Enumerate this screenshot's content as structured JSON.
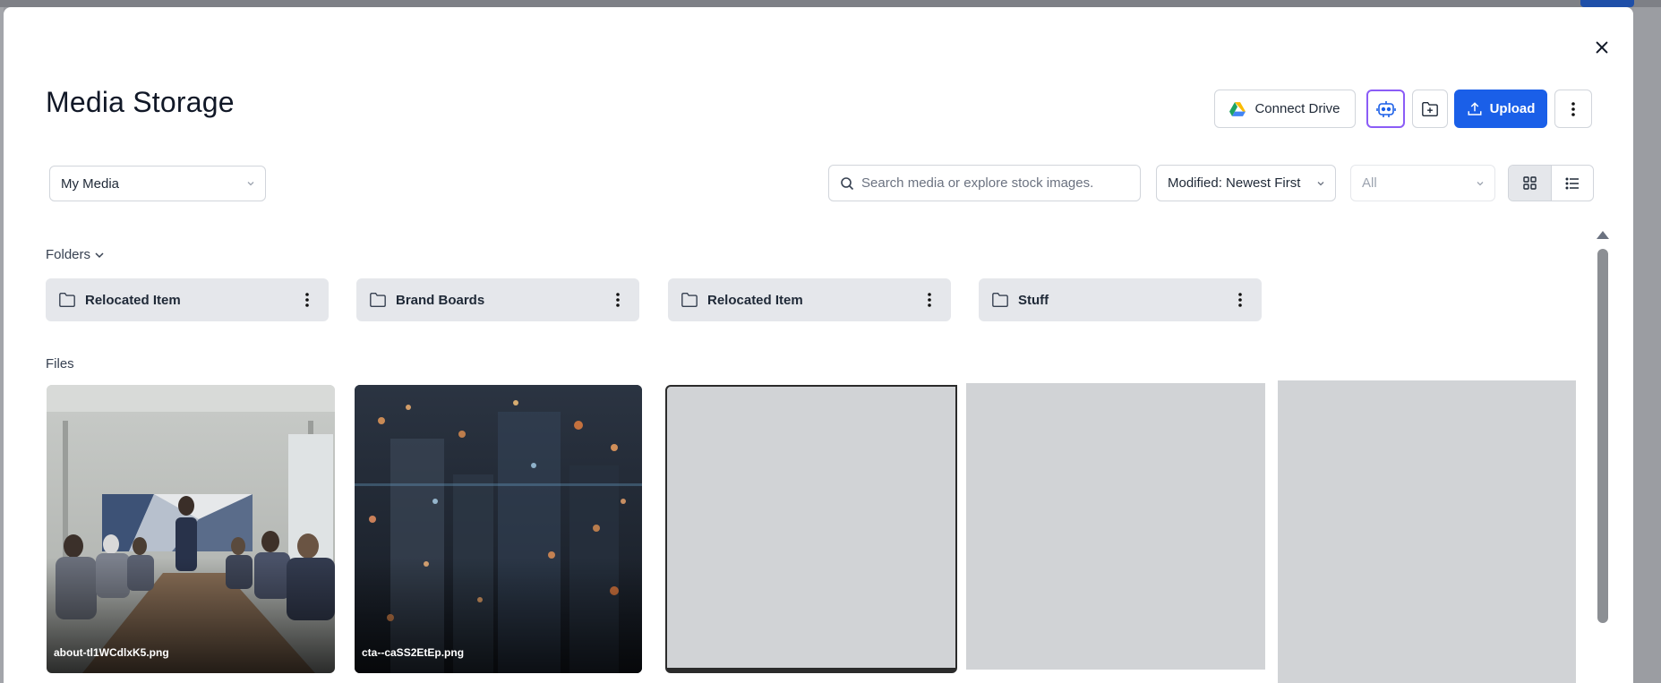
{
  "modal": {
    "title": "Media Storage",
    "close_icon": "close-icon"
  },
  "header": {
    "connect_drive_label": "Connect Drive",
    "upload_label": "Upload",
    "icons": [
      "google-drive-icon",
      "ai-robot-icon",
      "folder-add-icon",
      "upload-icon",
      "more-vertical-icon"
    ]
  },
  "filters": {
    "source_value": "My Media",
    "search_placeholder": "Search media or explore stock images.",
    "sort_value": "Modified: Newest First",
    "type_value": "All",
    "view_modes": [
      "grid-view-icon",
      "list-view-icon"
    ],
    "active_view": "grid"
  },
  "folders": {
    "label": "Folders",
    "items": [
      {
        "name": "Relocated Item"
      },
      {
        "name": "Brand Boards"
      },
      {
        "name": "Relocated Item"
      },
      {
        "name": "Stuff"
      }
    ]
  },
  "files": {
    "label": "Files",
    "items": [
      {
        "name": "about-tl1WCdlxK5.png",
        "thumbnail": "meeting-room-photo"
      },
      {
        "name": "cta--caSS2EtEp.png",
        "thumbnail": "night-city-bokeh-photo"
      },
      {
        "name": "",
        "thumbnail": "loading-placeholder"
      },
      {
        "name": "",
        "thumbnail": "loading-placeholder"
      },
      {
        "name": "",
        "thumbnail": "loading-placeholder"
      }
    ]
  },
  "colors": {
    "primary": "#1a5fe8",
    "ai_accent": "#8b5cf6",
    "folder_bg": "#e5e7eb",
    "placeholder": "#d1d3d6"
  }
}
